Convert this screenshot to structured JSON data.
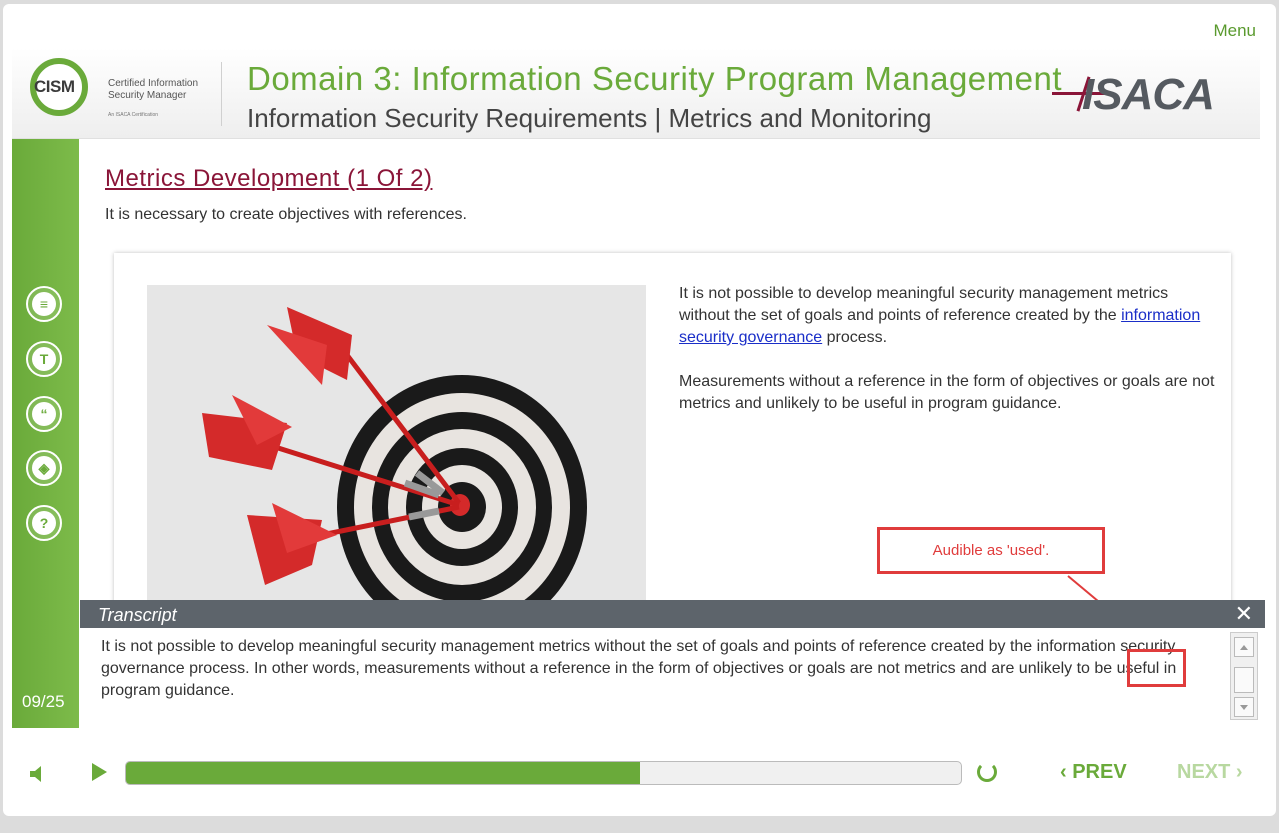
{
  "topbar": {
    "menu_label": "Menu"
  },
  "header": {
    "logo_left": {
      "main": "CISM",
      "line1": "Certified Information",
      "line2": "Security Manager",
      "line3": "An ISACA Certification"
    },
    "domain_title": "Domain 3: Information Security Program Management",
    "domain_subtitle": "Information Security Requirements | Metrics and Monitoring",
    "logo_right": "ISACA"
  },
  "sidebar": {
    "buttons": [
      {
        "icon": "document-icon",
        "glyph": "≡"
      },
      {
        "icon": "text-icon",
        "glyph": "T"
      },
      {
        "icon": "quote-icon",
        "glyph": "“"
      },
      {
        "icon": "layers-icon",
        "glyph": "◈"
      },
      {
        "icon": "help-icon",
        "glyph": "?"
      }
    ],
    "page_count": "09/25"
  },
  "slide": {
    "title": "Metrics Development (1 Of 2)",
    "intro": "It is necessary to create objectives with references.",
    "para1_pre": "It is not possible to develop meaningful security management metrics without the set of goals and points of reference created by the ",
    "para1_link": "information security governance",
    "para1_post": " process.",
    "para2": "Measurements without a reference in the form of objectives or goals are not metrics and unlikely to be useful in program guidance."
  },
  "callout": {
    "text": "Audible as 'used'."
  },
  "transcript": {
    "title": "Transcript",
    "close_glyph": "✕",
    "text": "It is not possible to develop meaningful security management metrics without the set of goals and points of reference created by the information security governance process. In other words, measurements without a reference in the form of objectives or goals are not metrics and are unlikely to be useful in program guidance."
  },
  "footer": {
    "progress_fraction": 0.615,
    "prev_label": "PREV",
    "next_label": "NEXT"
  },
  "colors": {
    "accent": "#6aaa3a",
    "title": "#8a1538",
    "link": "#1a2ec8",
    "annotation": "#e03c3c"
  }
}
